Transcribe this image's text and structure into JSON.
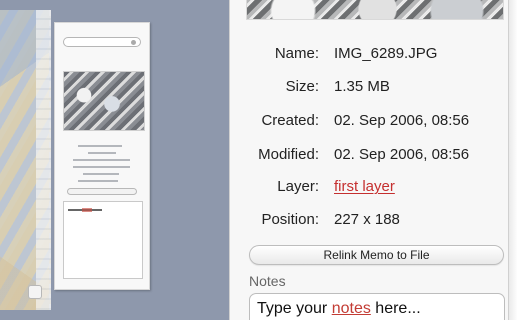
{
  "info": {
    "labels": {
      "name": "Name:",
      "size": "Size:",
      "created": "Created:",
      "modified": "Modified:",
      "layer": "Layer:",
      "position": "Position:"
    },
    "values": {
      "name": "IMG_6289.JPG",
      "size": "1.35 MB",
      "created": "02. Sep 2006, 08:56",
      "modified": "02. Sep 2006, 08:56",
      "layer": "first layer",
      "position": "227 x   188"
    },
    "relink_button": "Relink Memo to File",
    "notes_label": "Notes",
    "notes_text_prefix": "Type your ",
    "notes_text_highlight": "notes",
    "notes_text_suffix": " here..."
  },
  "colors": {
    "accent_link": "#c52f2f",
    "background": "#8c95a9",
    "panel": "#f7f7f7"
  },
  "icons": {
    "search": "search-icon",
    "image": "photo-thumbnail"
  }
}
